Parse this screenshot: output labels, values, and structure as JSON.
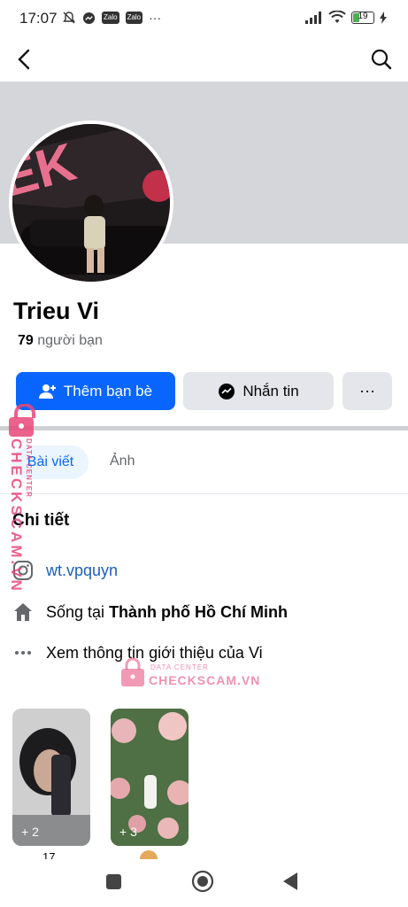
{
  "status_bar": {
    "time": "17:07",
    "app_badge_1": "Zalo",
    "app_badge_2": "Zalo",
    "more": "···",
    "battery": "19"
  },
  "profile": {
    "name": "Trieu Vi",
    "friends_count": "79",
    "friends_label": " người bạn",
    "add_friend_label": "Thêm bạn bè",
    "message_label": "Nhắn tin",
    "more_label": "···"
  },
  "tabs": {
    "posts": "Bài viết",
    "photos": "Ảnh"
  },
  "details": {
    "title": "Chi tiết",
    "instagram": "wt.vpquyn",
    "lives_prefix": "Sống tại ",
    "lives_city": "Thành phố Hồ Chí Minh",
    "about_link": "Xem thông tin giới thiệu của Vi"
  },
  "featured": [
    {
      "count": "+ 2",
      "caption": "17"
    },
    {
      "count": "+ 3",
      "caption": ""
    }
  ],
  "cover_text": "EK",
  "watermark": {
    "vertical": "CHECKSCAM.VN",
    "vertical_small": "DATA CENTER",
    "center_small": "DATA CENTER",
    "center": "CHECKSCAM.VN"
  },
  "colors": {
    "accent": "#0866ff",
    "watermark": "#e84778"
  }
}
